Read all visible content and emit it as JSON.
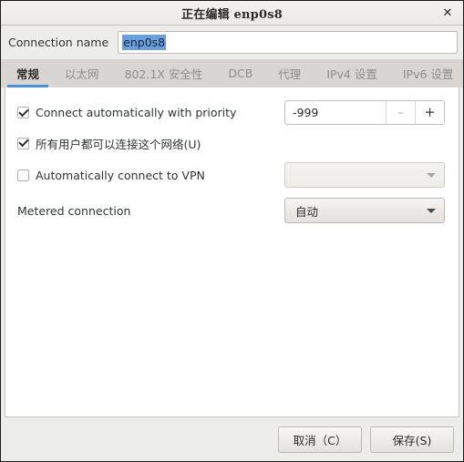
{
  "window": {
    "title": "正在编辑 enp0s8",
    "close_icon": "close-icon",
    "close_glyph": "✕"
  },
  "connection_name": {
    "label": "Connection name",
    "value": "enp0s8",
    "selected": true,
    "selection_color": "#6ca0dc"
  },
  "tabs": [
    {
      "label": "常规",
      "active": true
    },
    {
      "label": "以太网",
      "active": false
    },
    {
      "label": "802.1X 安全性",
      "active": false
    },
    {
      "label": "DCB",
      "active": false
    },
    {
      "label": "代理",
      "active": false
    },
    {
      "label": "IPv4 设置",
      "active": false
    },
    {
      "label": "IPv6 设置",
      "active": false
    }
  ],
  "tab_accent_color": "#4a90d9",
  "general": {
    "connect_auto": {
      "label": "Connect automatically with priority",
      "checked": true
    },
    "priority_spin": {
      "value": "-999",
      "decrement_glyph": "–",
      "increment_glyph": "+"
    },
    "all_users": {
      "label": "所有用户都可以连接这个网络(U)",
      "checked": true
    },
    "auto_vpn": {
      "label": "Automatically connect to VPN",
      "checked": false
    },
    "vpn_combo": {
      "value": "",
      "disabled": true
    },
    "metered": {
      "label": "Metered connection",
      "value": "自动"
    }
  },
  "footer": {
    "cancel_label": "取消（C）",
    "save_label": "保存(S)"
  }
}
